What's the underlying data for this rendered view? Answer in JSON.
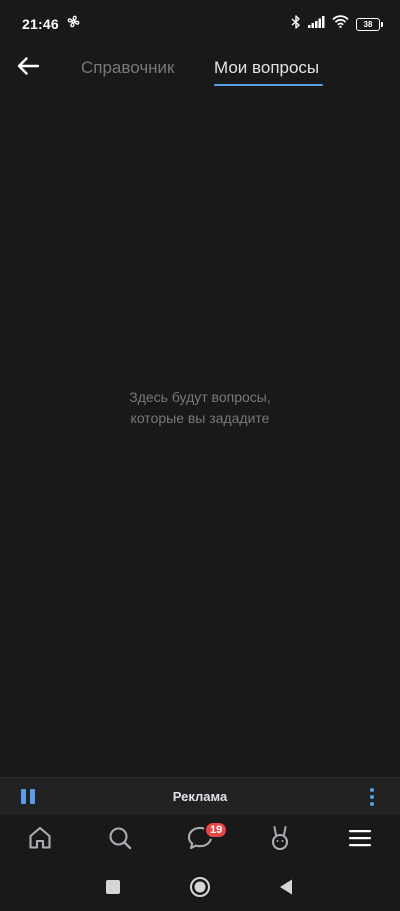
{
  "status_bar": {
    "time": "21:46",
    "battery": "38",
    "icons": [
      "fan-icon",
      "bluetooth-icon",
      "signal-icon",
      "wifi-icon",
      "battery-icon"
    ]
  },
  "nav": {
    "back_icon": "arrow-left-icon",
    "tabs": [
      {
        "label": "Справочник",
        "active": false
      },
      {
        "label": "Мои вопросы",
        "active": true
      }
    ]
  },
  "empty_state": {
    "line1": "Здесь будут вопросы,",
    "line2": "которые вы зададите"
  },
  "ad_bar": {
    "label": "Реклама",
    "pause_icon": "pause-icon",
    "menu_icon": "more-vertical-icon"
  },
  "tab_bar": {
    "items": [
      {
        "name": "home",
        "icon": "home-icon"
      },
      {
        "name": "search",
        "icon": "search-icon"
      },
      {
        "name": "messages",
        "icon": "message-icon",
        "badge": "19"
      },
      {
        "name": "clips",
        "icon": "clips-icon"
      },
      {
        "name": "menu",
        "icon": "menu-icon"
      }
    ]
  },
  "colors": {
    "background": "#19191a",
    "accent": "#5a9ee6",
    "badge": "#e64646",
    "text_primary": "#e1e3e6",
    "text_secondary": "#76787a"
  }
}
